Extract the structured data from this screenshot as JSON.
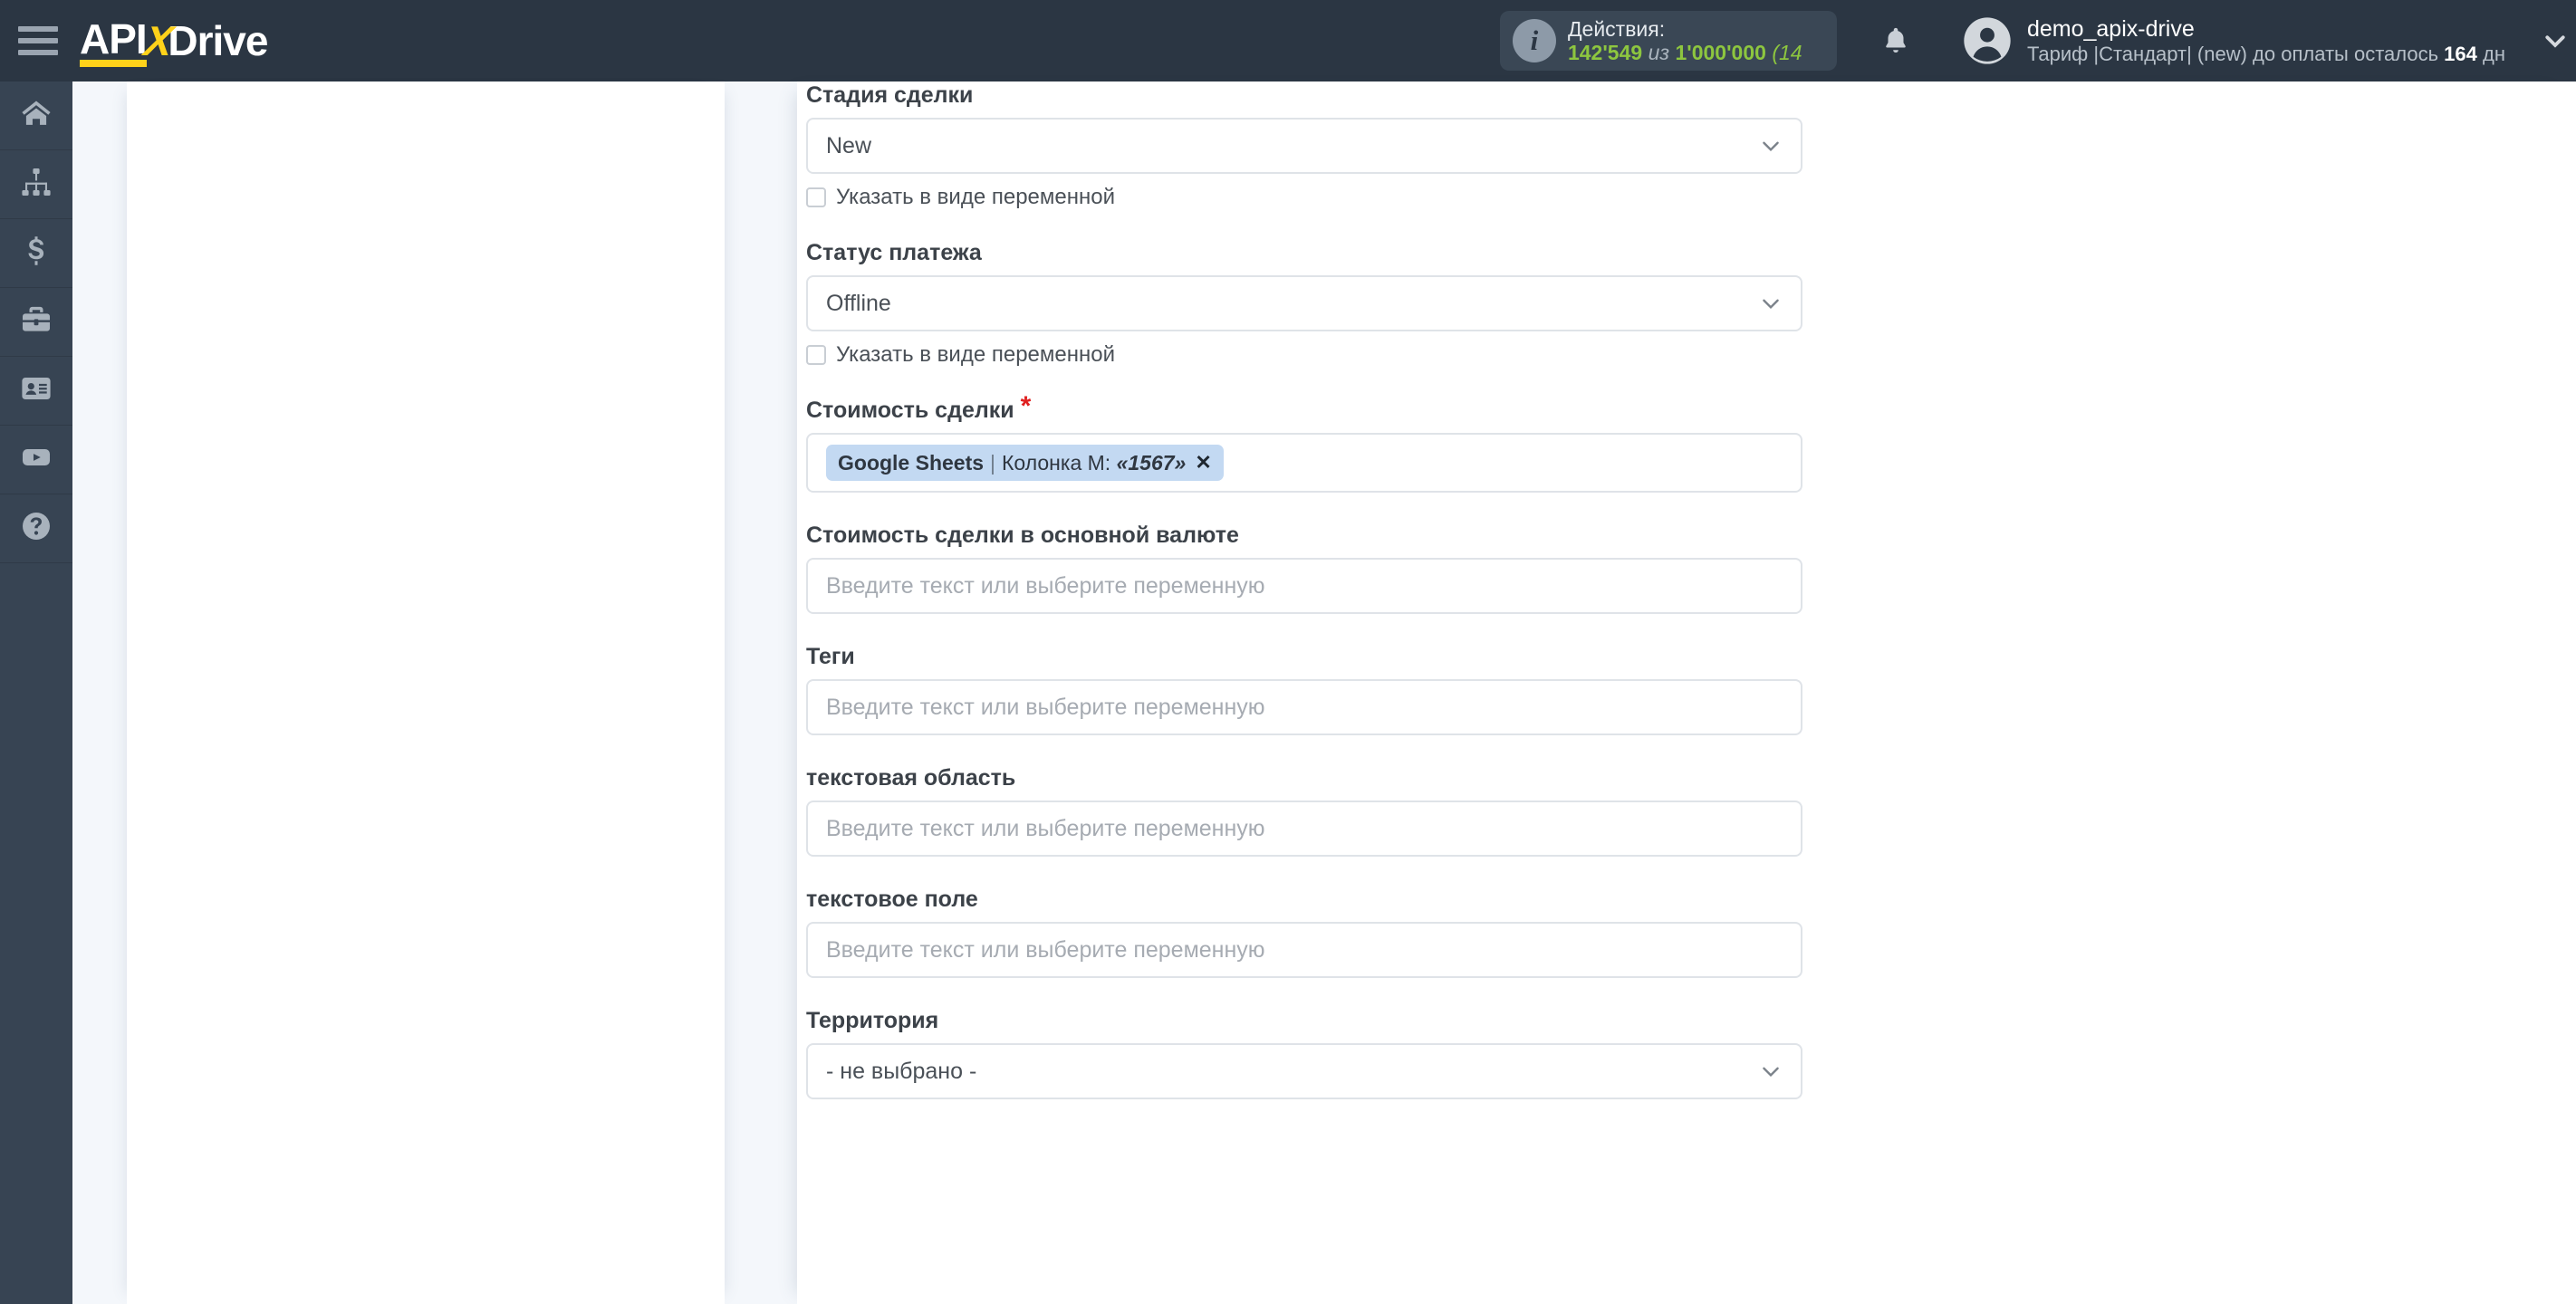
{
  "brand": {
    "logo_part1": "API",
    "logo_x": "X",
    "logo_part2": "Drive",
    "accent_yellow": "#ffd21a",
    "topbar_color": "#2b3643",
    "rail_color": "#374453",
    "green": "#8dc63f",
    "chip_bg": "#c3d9f2",
    "required_red": "#e02020"
  },
  "topbar": {
    "menu_icon": "hamburger-icon",
    "actions": {
      "icon": "info-icon",
      "title": "Действия:",
      "used": "142'549",
      "of": "из",
      "total": "1'000'000",
      "percent": "(14 "
    },
    "bell_icon": "bell-icon",
    "user": {
      "avatar_icon": "user-avatar-icon",
      "name": "demo_apix-drive",
      "plan_prefix": "Тариф |Стандарт| (new) до оплаты осталось ",
      "plan_days": "164",
      "plan_suffix": " дн",
      "caret_icon": "chevron-down-icon"
    }
  },
  "rail": {
    "items": [
      {
        "icon": "home-icon",
        "name": "sidebar-item-home"
      },
      {
        "icon": "connections-icon",
        "name": "sidebar-item-connections"
      },
      {
        "icon": "dollar-icon",
        "name": "sidebar-item-billing"
      },
      {
        "icon": "briefcase-icon",
        "name": "sidebar-item-business"
      },
      {
        "icon": "contact-card-icon",
        "name": "sidebar-item-contacts"
      },
      {
        "icon": "youtube-icon",
        "name": "sidebar-item-video"
      },
      {
        "icon": "help-icon",
        "name": "sidebar-item-help"
      }
    ]
  },
  "form": {
    "variable_checkbox_label": "Указать в виде переменной",
    "placeholder": "Введите текст или выберите переменную",
    "fields": [
      {
        "id": "deal-stage",
        "label": "Стадия сделки",
        "type": "select",
        "value": "New",
        "required": false,
        "has_variable_checkbox": true,
        "variable_checked": false
      },
      {
        "id": "payment-status",
        "label": "Статус платежа",
        "type": "select",
        "value": "Offline",
        "required": false,
        "has_variable_checkbox": true,
        "variable_checked": false
      },
      {
        "id": "deal-amount",
        "label": "Стоимость сделки",
        "type": "chips",
        "required": true,
        "chip": {
          "source": "Google Sheets",
          "separator": "|",
          "column_label": "Колонка M:",
          "column_value": "«1567»",
          "remove_icon": "✕"
        }
      },
      {
        "id": "deal-amount-base-currency",
        "label": "Стоимость сделки в основной валюте",
        "type": "text",
        "value": "",
        "required": false
      },
      {
        "id": "tags",
        "label": "Теги",
        "type": "text",
        "value": "",
        "required": false
      },
      {
        "id": "textarea-field",
        "label": "текстовая область",
        "type": "text",
        "value": "",
        "required": false
      },
      {
        "id": "textfield-field",
        "label": "текстовое поле",
        "type": "text",
        "value": "",
        "required": false
      },
      {
        "id": "territory",
        "label": "Территория",
        "type": "select",
        "value": "- не выбрано -",
        "required": false
      }
    ]
  }
}
